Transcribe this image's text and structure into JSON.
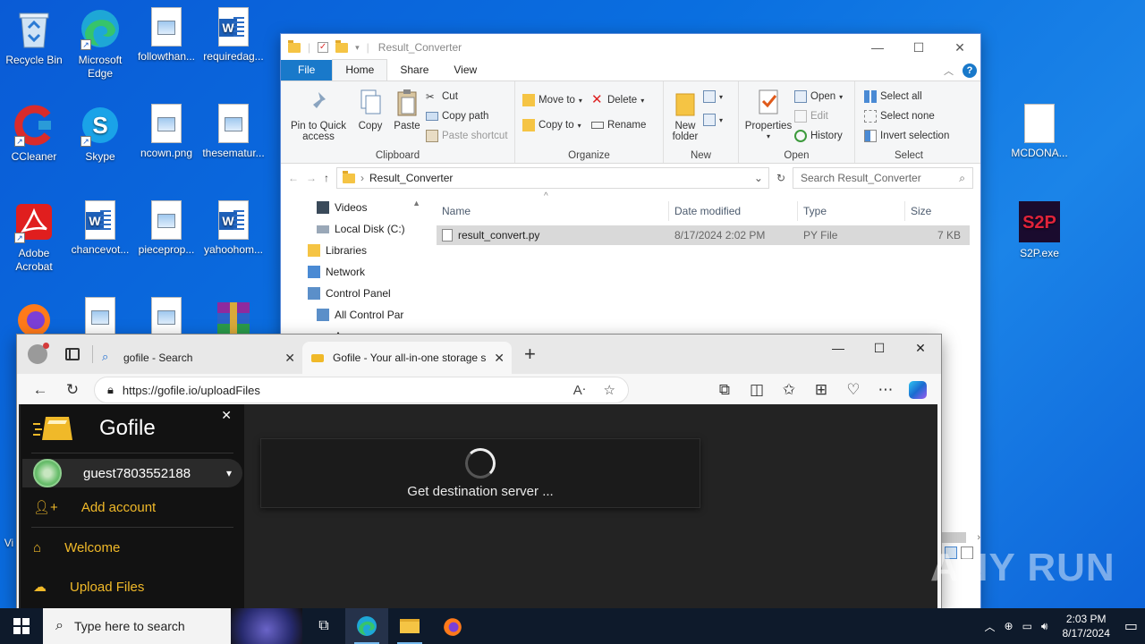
{
  "desktop": {
    "icons": [
      {
        "label": "Recycle Bin"
      },
      {
        "label": "Microsoft Edge"
      },
      {
        "label": "followthan..."
      },
      {
        "label": "requiredag..."
      },
      {
        "label": "CCleaner"
      },
      {
        "label": "Skype"
      },
      {
        "label": "ncown.png"
      },
      {
        "label": "thesematur..."
      },
      {
        "label": "Adobe Acrobat"
      },
      {
        "label": "chancevot..."
      },
      {
        "label": "pieceprop..."
      },
      {
        "label": "yahoohom..."
      },
      {
        "label": "MCDONA..."
      },
      {
        "label": "S2P.exe"
      },
      {
        "label": "Vi"
      }
    ],
    "watermark": "ANY RUN"
  },
  "explorer": {
    "title": "Result_Converter",
    "tabs": [
      "File",
      "Home",
      "Share",
      "View"
    ],
    "groups": {
      "clipboard": {
        "name": "Clipboard",
        "pin": "Pin to Quick access",
        "copy": "Copy",
        "paste": "Paste",
        "cut": "Cut",
        "copy_path": "Copy path",
        "paste_shortcut": "Paste shortcut"
      },
      "organize": {
        "name": "Organize",
        "move_to": "Move to",
        "copy_to": "Copy to",
        "delete": "Delete",
        "rename": "Rename"
      },
      "new": {
        "name": "New",
        "new_folder": "New folder"
      },
      "open": {
        "name": "Open",
        "properties": "Properties",
        "open": "Open",
        "edit": "Edit",
        "history": "History"
      },
      "select": {
        "name": "Select",
        "select_all": "Select all",
        "select_none": "Select none",
        "invert": "Invert selection"
      }
    },
    "address": "Result_Converter",
    "search_placeholder": "Search Result_Converter",
    "nav": [
      "Videos",
      "Local Disk (C:)",
      "Libraries",
      "Network",
      "Control Panel",
      "All Control Par",
      "A"
    ],
    "columns": [
      "Name",
      "Date modified",
      "Type",
      "Size"
    ],
    "files": [
      {
        "name": "result_convert.py",
        "date": "8/17/2024 2:02 PM",
        "type": "PY File",
        "size": "7 KB"
      }
    ]
  },
  "edge": {
    "tabs": [
      {
        "title": "gofile - Search"
      },
      {
        "title": "Gofile - Your all-in-one storage s"
      }
    ],
    "url": "https://gofile.io/uploadFiles",
    "gofile": {
      "brand": "Gofile",
      "user": "guest7803552188",
      "menu": [
        "Add account",
        "Welcome",
        "Upload Files"
      ],
      "status": "Get destination server ..."
    }
  },
  "taskbar": {
    "search_placeholder": "Type here to search",
    "time": "2:03 PM",
    "date": "8/17/2024"
  }
}
